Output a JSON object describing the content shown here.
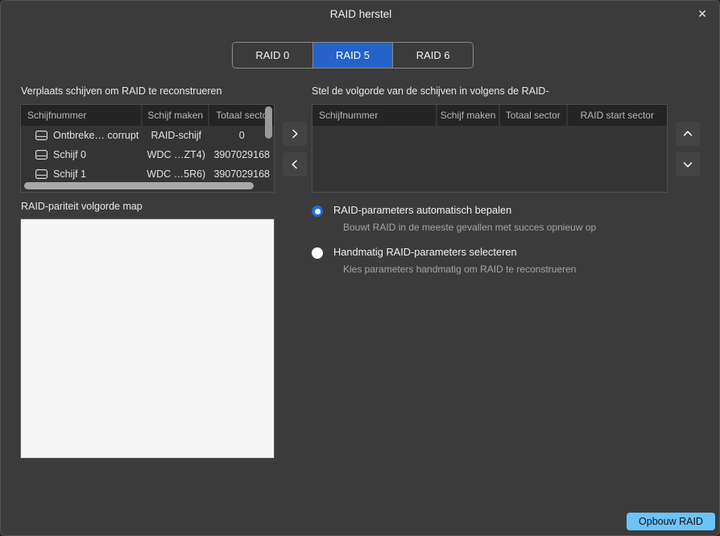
{
  "window": {
    "title": "RAID herstel",
    "close_label": "✕"
  },
  "tabs": [
    {
      "label": "RAID 0",
      "active": false
    },
    {
      "label": "RAID 5",
      "active": true
    },
    {
      "label": "RAID 6",
      "active": false
    }
  ],
  "left_panel": {
    "label": "Verplaats schijven om RAID te reconstrueren",
    "columns": [
      "Schijfnummer",
      "Schijf maken",
      "Totaal secto"
    ],
    "rows": [
      {
        "icon": "disk-icon",
        "number": "Ontbreke… corrupt",
        "make": "RAID-schijf",
        "total": "0"
      },
      {
        "icon": "disk-icon",
        "number": "Schijf 0",
        "make": "WDC …ZT4)",
        "total": "3907029168"
      },
      {
        "icon": "disk-icon",
        "number": "Schijf 1",
        "make": "WDC …5R6)",
        "total": "3907029168"
      }
    ]
  },
  "right_panel": {
    "label": "Stel de volgorde van de schijven in volgens de RAID-",
    "columns": [
      "Schijfnummer",
      "Schijf maken",
      "Totaal sector",
      "RAID start sector"
    ],
    "rows": []
  },
  "move_buttons": {
    "right": "chevron-right-icon",
    "left": "chevron-left-icon",
    "up": "chevron-up-icon",
    "down": "chevron-down-icon"
  },
  "parity_map": {
    "label": "RAID-pariteit volgorde map"
  },
  "options": [
    {
      "title": "RAID-parameters automatisch bepalen",
      "subtitle": "Bouwt RAID in de meeste gevallen met succes opnieuw op",
      "selected": true
    },
    {
      "title": "Handmatig RAID-parameters selecteren",
      "subtitle": "Kies parameters handmatig om RAID te reconstrueren",
      "selected": false
    }
  ],
  "footer": {
    "build_label": "Opbouw RAID"
  },
  "colors": {
    "accent": "#2563c9",
    "radio_accent": "#1a6fe0",
    "button": "#6cc3fa",
    "dialog_bg": "#3b3b3b",
    "header_bg": "#242424",
    "parity_bg": "#f5f5f5"
  }
}
